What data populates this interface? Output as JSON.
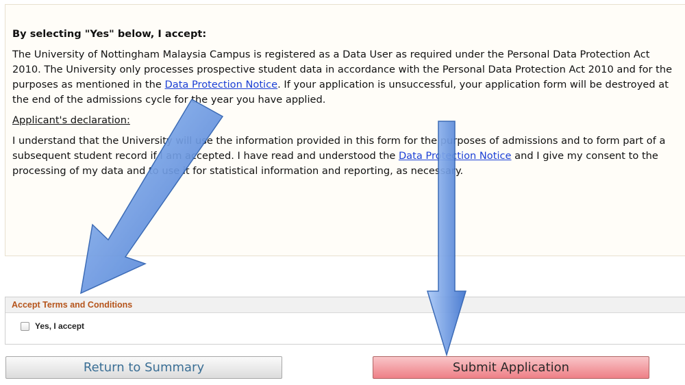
{
  "notice": {
    "heading": "By selecting \"Yes\" below, I accept:",
    "para1_part1": "The University of Nottingham Malaysia Campus is registered as a Data User as required under the Personal Data Protection Act 2010. The University only processes prospective student data in accordance with the Personal Data Protection Act 2010 and for the purposes as mentioned in the ",
    "para1_link": "Data Protection Notice",
    "para1_part2": ". If your application is unsuccessful, your application form will be destroyed at the end of the admissions cycle for the year you have applied.",
    "declaration_label": "Applicant's declaration:",
    "para2_part1": "I understand that the University will use the information provided in this form for the purposes of admissions and to form part of a subsequent student record if I am accepted. I have read and understood the ",
    "para2_link": "Data Protection Notice",
    "para2_part2": " and I give my consent to the processing of my data and to use it for statistical information and reporting, as necessary."
  },
  "terms": {
    "header": "Accept Terms and Conditions",
    "checkbox_label": "Yes, I accept"
  },
  "buttons": {
    "return_label": "Return to Summary",
    "submit_label": "Submit Application"
  },
  "colors": {
    "link": "#1a3fd6",
    "terms_header": "#b5541b",
    "submit_bg": "#ee7f86",
    "arrow": "#4a7fd6"
  }
}
